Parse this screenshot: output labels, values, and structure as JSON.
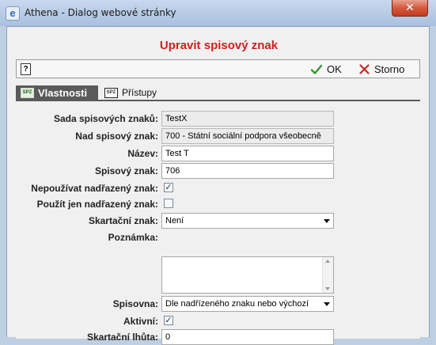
{
  "window": {
    "title": "Athena - Dialog webové stránky",
    "close_glyph": "✕",
    "app_icon": "e"
  },
  "dialog": {
    "heading": "Upravit spisový znak"
  },
  "toolbar": {
    "help_glyph": "?",
    "ok_label": "OK",
    "cancel_label": "Storno",
    "ok_color": "#2f9a2f",
    "cancel_color": "#c62828"
  },
  "tabs": [
    {
      "label": "Vlastnosti",
      "icon": "SPZ",
      "active": true
    },
    {
      "label": "Přístupy",
      "icon": "SPZ",
      "active": false
    }
  ],
  "form": {
    "sada": {
      "label": "Sada spisových znaků:",
      "value": "TestX"
    },
    "nad": {
      "label": "Nad spisový znak:",
      "value": "700 - Státní sociální podpora všeobecně"
    },
    "nazev": {
      "label": "Název:",
      "value": "Test T"
    },
    "znak": {
      "label": "Spisový znak:",
      "value": "706"
    },
    "nepouzivat": {
      "label": "Nepoužívat nadřazený znak:",
      "checked": true
    },
    "pouzit": {
      "label": "Použít jen nadřazený znak:",
      "checked": false
    },
    "skartacni_znak": {
      "label": "Skartační znak:",
      "value": "Není"
    },
    "poznamka": {
      "label": "Poznámka:",
      "value": ""
    },
    "spisovna": {
      "label": "Spisovna:",
      "value": "Dle nadřízeného znaku nebo výchozí"
    },
    "aktivni": {
      "label": "Aktivní:",
      "checked": true
    },
    "lhuta": {
      "label": "Skartační lhůta:",
      "value": "0"
    }
  }
}
